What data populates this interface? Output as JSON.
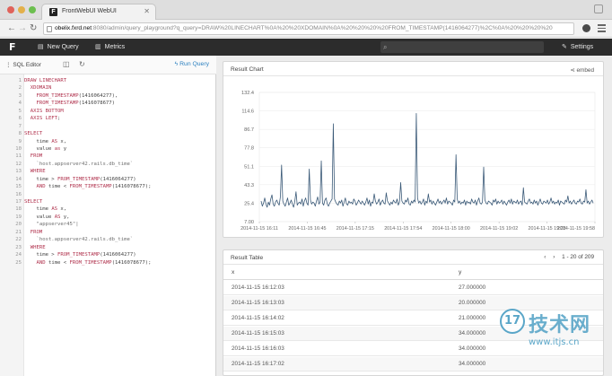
{
  "browser": {
    "tab_title": "FrontWebUI WebUI",
    "tab_favicon": "F",
    "url_host": "obelix.fxrd.net",
    "url_path": ":8080/admin/query_playground?q_query=DRAW%20LINECHART%0A%20%20XDOMAIN%0A%20%20%20%20FROM_TIMESTAMP(1416064277)%2C%0A%20%20%20%20"
  },
  "appnav": {
    "logo": "F",
    "new_query": "New Query",
    "metrics": "Metrics",
    "settings": "Settings"
  },
  "editor": {
    "tab_label": "SQL Editor",
    "run_label": "Run Query",
    "lines": [
      [
        {
          "t": "kw",
          "v": "DRAW LINECHART"
        }
      ],
      [
        {
          "t": "kw",
          "v": "  XDOMAIN"
        }
      ],
      [
        {
          "t": "kw",
          "v": "    FROM_TIMESTAMP"
        },
        {
          "t": "tx",
          "v": "(1416064277),"
        }
      ],
      [
        {
          "t": "kw",
          "v": "    FROM_TIMESTAMP"
        },
        {
          "t": "tx",
          "v": "(1416078677)"
        }
      ],
      [
        {
          "t": "kw",
          "v": "  AXIS BOTTOM"
        }
      ],
      [
        {
          "t": "kw",
          "v": "  AXIS LEFT"
        },
        {
          "t": "tx",
          "v": ";"
        }
      ],
      [
        {
          "t": "tx",
          "v": ""
        }
      ],
      [
        {
          "t": "kw",
          "v": "SELECT"
        }
      ],
      [
        {
          "t": "tx",
          "v": "    time "
        },
        {
          "t": "kw",
          "v": "AS"
        },
        {
          "t": "tx",
          "v": " x,"
        }
      ],
      [
        {
          "t": "tx",
          "v": "    value "
        },
        {
          "t": "kw",
          "v": "as"
        },
        {
          "t": "tx",
          "v": " y"
        }
      ],
      [
        {
          "t": "kw",
          "v": "  FROM"
        }
      ],
      [
        {
          "t": "str",
          "v": "    `host.appserver42.rails.db_time`"
        }
      ],
      [
        {
          "t": "kw",
          "v": "  WHERE"
        }
      ],
      [
        {
          "t": "tx",
          "v": "    time > "
        },
        {
          "t": "kw",
          "v": "FROM_TIMESTAMP"
        },
        {
          "t": "tx",
          "v": "(1416064277)"
        }
      ],
      [
        {
          "t": "kw",
          "v": "    AND"
        },
        {
          "t": "tx",
          "v": " time < "
        },
        {
          "t": "kw",
          "v": "FROM_TIMESTAMP"
        },
        {
          "t": "tx",
          "v": "(1416078677);"
        }
      ],
      [
        {
          "t": "tx",
          "v": ""
        }
      ],
      [
        {
          "t": "kw",
          "v": "SELECT"
        }
      ],
      [
        {
          "t": "tx",
          "v": "    time "
        },
        {
          "t": "kw",
          "v": "AS"
        },
        {
          "t": "tx",
          "v": " x,"
        }
      ],
      [
        {
          "t": "tx",
          "v": "    value "
        },
        {
          "t": "kw",
          "v": "AS"
        },
        {
          "t": "tx",
          "v": " y,"
        }
      ],
      [
        {
          "t": "str",
          "v": "    \"appserver45\"|"
        }
      ],
      [
        {
          "t": "kw",
          "v": "  FROM"
        }
      ],
      [
        {
          "t": "str",
          "v": "    `host.appserver42.rails.db_time`"
        }
      ],
      [
        {
          "t": "kw",
          "v": "  WHERE"
        }
      ],
      [
        {
          "t": "tx",
          "v": "    time > "
        },
        {
          "t": "kw",
          "v": "FROM_TIMESTAMP"
        },
        {
          "t": "tx",
          "v": "(1416064277)"
        }
      ],
      [
        {
          "t": "kw",
          "v": "    AND"
        },
        {
          "t": "tx",
          "v": " time < "
        },
        {
          "t": "kw",
          "v": "FROM_TIMESTAMP"
        },
        {
          "t": "tx",
          "v": "(1416078677);"
        }
      ]
    ]
  },
  "chart_panel": {
    "title": "Result Chart",
    "share_label": "embed"
  },
  "chart_data": {
    "type": "line",
    "title": "",
    "xlabel": "",
    "ylabel": "",
    "ylim": [
      7.0,
      132.4
    ],
    "yticks": [
      "132.4",
      "114.6",
      "86.7",
      "77.8",
      "51.1",
      "43.3",
      "25.4",
      "7.00"
    ],
    "xticks": [
      "2014-11-15 16:11",
      "2014-11-15 16:45",
      "2014-11-15 17:15",
      "2014-11-15 17:54",
      "2014-11-15 18:00",
      "2014-11-15 19:02",
      "2014-11-15 19:28",
      "2014-11-15 19:58"
    ],
    "grid": true,
    "series": [
      {
        "color": "#3b5a78",
        "values": [
          27,
          22,
          25,
          30,
          24,
          21,
          26,
          23,
          29,
          33,
          24,
          22,
          26,
          28,
          25,
          23,
          31,
          62,
          27,
          24,
          22,
          26,
          30,
          23,
          25,
          28,
          24,
          21,
          27,
          36,
          23,
          25,
          26,
          24,
          29,
          22,
          27,
          30,
          25,
          23,
          58,
          28,
          24,
          26,
          25,
          22,
          27,
          31,
          24,
          26,
          66,
          25,
          23,
          28,
          30,
          24,
          22,
          25,
          27,
          29,
          102,
          29,
          26,
          24,
          23,
          27,
          25,
          28,
          22,
          26,
          30,
          24,
          23,
          27,
          25,
          26,
          24,
          29,
          27,
          23,
          25,
          28,
          26,
          24,
          27,
          25,
          23,
          26,
          30,
          24,
          28,
          22,
          26,
          25,
          34,
          27,
          24,
          26,
          29,
          23,
          26,
          28,
          25,
          24,
          35,
          27,
          25,
          23,
          26,
          24,
          28,
          26,
          25,
          29,
          23,
          26,
          45,
          27,
          25,
          24,
          28,
          26,
          30,
          24,
          23,
          27,
          25,
          28,
          26,
          112,
          30,
          25,
          27,
          24,
          26,
          29,
          23,
          27,
          25,
          34,
          26,
          28,
          24,
          27,
          25,
          23,
          26,
          29,
          25,
          27,
          24,
          26,
          28,
          25,
          30,
          24,
          27,
          26,
          25,
          23,
          28,
          26,
          72,
          29,
          25,
          27,
          24,
          26,
          25,
          28,
          23,
          27,
          25,
          26,
          24,
          29,
          26,
          25,
          28,
          23,
          27,
          30,
          25,
          24,
          26,
          60,
          28,
          25,
          24,
          27,
          26,
          25,
          23,
          28,
          26,
          29,
          24,
          27,
          25,
          26,
          28,
          24,
          27,
          25,
          23,
          26,
          28,
          25,
          29,
          24,
          27,
          26,
          25,
          28,
          24,
          26,
          27,
          23,
          40,
          26,
          25,
          24,
          27,
          29,
          25,
          26,
          24,
          28,
          25,
          27,
          23,
          26,
          29,
          25,
          24,
          27,
          26,
          25,
          28,
          24,
          26,
          30,
          25,
          27,
          24,
          26,
          25,
          28,
          23,
          27,
          26,
          25,
          24,
          28,
          26,
          32,
          25,
          27,
          24,
          26,
          28,
          25,
          24,
          27,
          26,
          29,
          25,
          24,
          27,
          26,
          38,
          25,
          27,
          24,
          26,
          28,
          25
        ]
      }
    ]
  },
  "table_panel": {
    "title": "Result Table",
    "pager_text": "1 - 20 of 209",
    "columns": [
      "x",
      "y"
    ],
    "rows": [
      [
        "2014-11-15 16:12:03",
        "27.000000"
      ],
      [
        "2014-11-15 16:13:03",
        "20.000000"
      ],
      [
        "2014-11-15 16:14:02",
        "21.000000"
      ],
      [
        "2014-11-15 16:15:03",
        "34.000000"
      ],
      [
        "2014-11-15 16:16:03",
        "34.000000"
      ],
      [
        "2014-11-15 16:17:02",
        "34.000000"
      ]
    ]
  },
  "watermark": {
    "badge": "17",
    "brand": "技术网",
    "url": "www.itjs.cn"
  }
}
